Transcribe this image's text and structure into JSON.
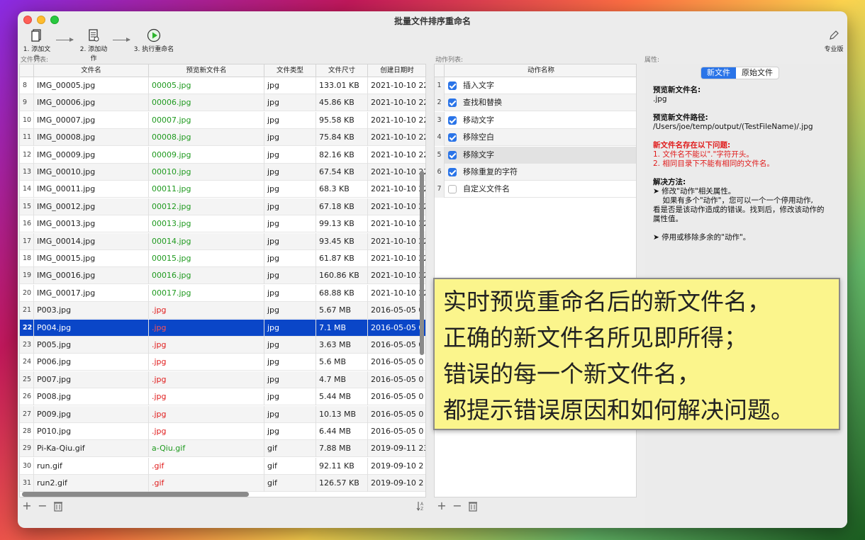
{
  "window": {
    "title": "批量文件排序重命名"
  },
  "toolbar": {
    "add_files": "1. 添加文件",
    "add_actions": "2. 添加动作",
    "execute": "3. 执行重命名",
    "pro": "专业版"
  },
  "files": {
    "section_label": "文件列表:",
    "columns": [
      "文件名",
      "预览新文件名",
      "文件类型",
      "文件尺寸",
      "创建日期时"
    ],
    "rows": [
      {
        "n": "8",
        "name": "IMG_00005.jpg",
        "preview": "00005.jpg",
        "ok": true,
        "type": "jpg",
        "size": "133.01 KB",
        "date": "2021-10-10 22"
      },
      {
        "n": "9",
        "name": "IMG_00006.jpg",
        "preview": "00006.jpg",
        "ok": true,
        "type": "jpg",
        "size": "45.86 KB",
        "date": "2021-10-10 22"
      },
      {
        "n": "10",
        "name": "IMG_00007.jpg",
        "preview": "00007.jpg",
        "ok": true,
        "type": "jpg",
        "size": "95.58 KB",
        "date": "2021-10-10 22"
      },
      {
        "n": "11",
        "name": "IMG_00008.jpg",
        "preview": "00008.jpg",
        "ok": true,
        "type": "jpg",
        "size": "75.84 KB",
        "date": "2021-10-10 22"
      },
      {
        "n": "12",
        "name": "IMG_00009.jpg",
        "preview": "00009.jpg",
        "ok": true,
        "type": "jpg",
        "size": "82.16 KB",
        "date": "2021-10-10 22"
      },
      {
        "n": "13",
        "name": "IMG_00010.jpg",
        "preview": "00010.jpg",
        "ok": true,
        "type": "jpg",
        "size": "67.54 KB",
        "date": "2021-10-10 22"
      },
      {
        "n": "14",
        "name": "IMG_00011.jpg",
        "preview": "00011.jpg",
        "ok": true,
        "type": "jpg",
        "size": "68.3 KB",
        "date": "2021-10-10 22"
      },
      {
        "n": "15",
        "name": "IMG_00012.jpg",
        "preview": "00012.jpg",
        "ok": true,
        "type": "jpg",
        "size": "67.18 KB",
        "date": "2021-10-10 22"
      },
      {
        "n": "16",
        "name": "IMG_00013.jpg",
        "preview": "00013.jpg",
        "ok": true,
        "type": "jpg",
        "size": "99.13 KB",
        "date": "2021-10-10 22"
      },
      {
        "n": "17",
        "name": "IMG_00014.jpg",
        "preview": "00014.jpg",
        "ok": true,
        "type": "jpg",
        "size": "93.45 KB",
        "date": "2021-10-10 22"
      },
      {
        "n": "18",
        "name": "IMG_00015.jpg",
        "preview": "00015.jpg",
        "ok": true,
        "type": "jpg",
        "size": "61.87 KB",
        "date": "2021-10-10 22"
      },
      {
        "n": "19",
        "name": "IMG_00016.jpg",
        "preview": "00016.jpg",
        "ok": true,
        "type": "jpg",
        "size": "160.86 KB",
        "date": "2021-10-10 22"
      },
      {
        "n": "20",
        "name": "IMG_00017.jpg",
        "preview": "00017.jpg",
        "ok": true,
        "type": "jpg",
        "size": "68.88 KB",
        "date": "2021-10-10 22"
      },
      {
        "n": "21",
        "name": "P003.jpg",
        "preview": ".jpg",
        "ok": false,
        "type": "jpg",
        "size": "5.67 MB",
        "date": "2016-05-05 0"
      },
      {
        "n": "22",
        "name": "P004.jpg",
        "preview": ".jpg",
        "ok": false,
        "type": "jpg",
        "size": "7.1 MB",
        "date": "2016-05-05 0",
        "selected": true
      },
      {
        "n": "23",
        "name": "P005.jpg",
        "preview": ".jpg",
        "ok": false,
        "type": "jpg",
        "size": "3.63 MB",
        "date": "2016-05-05 0"
      },
      {
        "n": "24",
        "name": "P006.jpg",
        "preview": ".jpg",
        "ok": false,
        "type": "jpg",
        "size": "5.6 MB",
        "date": "2016-05-05 0"
      },
      {
        "n": "25",
        "name": "P007.jpg",
        "preview": ".jpg",
        "ok": false,
        "type": "jpg",
        "size": "4.7 MB",
        "date": "2016-05-05 0"
      },
      {
        "n": "26",
        "name": "P008.jpg",
        "preview": ".jpg",
        "ok": false,
        "type": "jpg",
        "size": "5.44 MB",
        "date": "2016-05-05 0"
      },
      {
        "n": "27",
        "name": "P009.jpg",
        "preview": ".jpg",
        "ok": false,
        "type": "jpg",
        "size": "10.13 MB",
        "date": "2016-05-05 0"
      },
      {
        "n": "28",
        "name": "P010.jpg",
        "preview": ".jpg",
        "ok": false,
        "type": "jpg",
        "size": "6.44 MB",
        "date": "2016-05-05 0"
      },
      {
        "n": "29",
        "name": "Pi-Ka-Qiu.gif",
        "preview": "a-Qiu.gif",
        "ok": true,
        "type": "gif",
        "size": "7.88 MB",
        "date": "2019-09-11 23"
      },
      {
        "n": "30",
        "name": "run.gif",
        "preview": ".gif",
        "ok": false,
        "type": "gif",
        "size": "92.11 KB",
        "date": "2019-09-10 2"
      },
      {
        "n": "31",
        "name": "run2.gif",
        "preview": ".gif",
        "ok": false,
        "type": "gif",
        "size": "126.57 KB",
        "date": "2019-09-10 2"
      }
    ]
  },
  "actions": {
    "section_label": "动作列表:",
    "column": "动作名称",
    "items": [
      {
        "n": "1",
        "label": "插入文字",
        "checked": true
      },
      {
        "n": "2",
        "label": "查找和替换",
        "checked": true
      },
      {
        "n": "3",
        "label": "移动文字",
        "checked": true
      },
      {
        "n": "4",
        "label": "移除空白",
        "checked": true
      },
      {
        "n": "5",
        "label": "移除文字",
        "checked": true,
        "highlighted": true
      },
      {
        "n": "6",
        "label": "移除重复的字符",
        "checked": true
      },
      {
        "n": "7",
        "label": "自定义文件名",
        "checked": false
      }
    ]
  },
  "properties": {
    "section_label": "属性:",
    "tab_new": "新文件",
    "tab_original": "原始文件",
    "preview_name_title": "预览新文件名:",
    "preview_name_value": ".jpg",
    "preview_path_title": "预览新文件路径:",
    "preview_path_value": "/Users/joe/temp/output/(TestFileName)/.jpg",
    "problems_title": "新文件名存在以下问题:",
    "problem_1": "1. 文件名不能以\".\"字符开头。",
    "problem_2": "2. 相同目录下不能有相同的文件名。",
    "solution_title": "解决方法:",
    "solution_1": "➤ 修改\"动作\"相关属性。",
    "solution_1_detail": "    如果有多个\"动作\"，您可以一个一个停用动作,\n看是否是该动作造成的错误。找到后，修改该动作的\n属性值。",
    "solution_2": "➤ 停用或移除多余的\"动作\"。"
  },
  "callout": {
    "line1": "实时预览重命名后的新文件名，",
    "line2": "正确的新文件名所见即所得；",
    "line3": "错误的每一个新文件名，",
    "line4": "都提示错误原因和如何解决问题。"
  },
  "icons": {
    "add": "+",
    "remove": "−",
    "trash": "trash-icon",
    "sort": "sort-az-icon"
  }
}
